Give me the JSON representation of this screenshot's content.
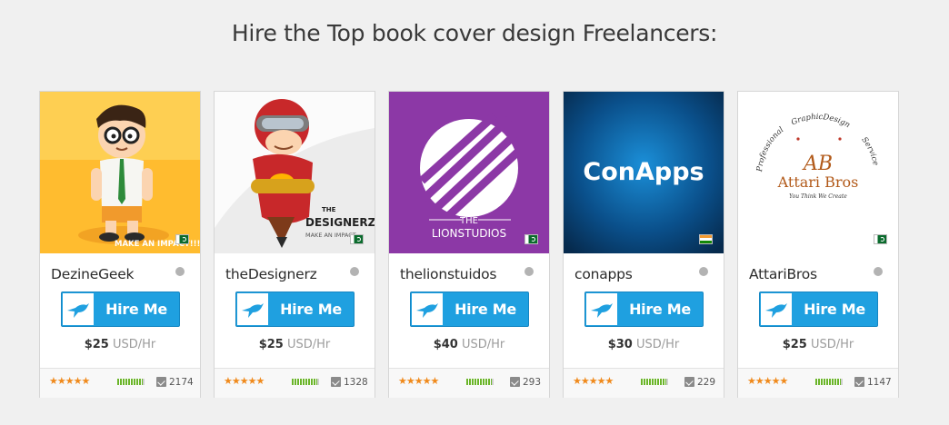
{
  "page": {
    "title": "Hire the Top book cover design Freelancers:"
  },
  "colors": {
    "hire_button": "#1fa0e0",
    "stars": "#f08a1c",
    "bars": "#6bb52a",
    "status_offline": "#b3b3b3"
  },
  "hire_label": "Hire Me",
  "rate_unit": "USD/Hr",
  "freelancers": [
    {
      "name": "DezineGeek",
      "rate": "$25",
      "reviews": "2174",
      "rating": 5,
      "flag": "pakistan-flag-icon",
      "avatar_text": "MAKE AN IMPACT!!!",
      "completion": 0.95
    },
    {
      "name": "theDesignerz",
      "rate": "$25",
      "reviews": "1328",
      "rating": 5,
      "flag": "pakistan-flag-icon",
      "avatar_text_1": "THE",
      "avatar_text_2": "DESIGNERZ",
      "avatar_text_3": "MAKE AN IMPACT",
      "completion": 0.95
    },
    {
      "name": "thelionstuidos",
      "rate": "$40",
      "reviews": "293",
      "rating": 5,
      "flag": "pakistan-flag-icon",
      "avatar_text_1": "THE",
      "avatar_text_2": "LIONSTUDIOS",
      "completion": 0.95
    },
    {
      "name": "conapps",
      "rate": "$30",
      "reviews": "229",
      "rating": 5,
      "flag": "india-flag-icon",
      "avatar_text": "ConApps",
      "completion": 0.95
    },
    {
      "name": "AttariBros",
      "rate": "$25",
      "reviews": "1147",
      "rating": 5,
      "flag": "pakistan-flag-icon",
      "avatar_text_1": "Professional",
      "avatar_text_2": "GraphicDesign",
      "avatar_text_3": "Service",
      "avatar_text_4": "AB",
      "avatar_text_5": "Attari Bros",
      "avatar_text_6": "You Think We Create",
      "completion": 0.95
    }
  ]
}
